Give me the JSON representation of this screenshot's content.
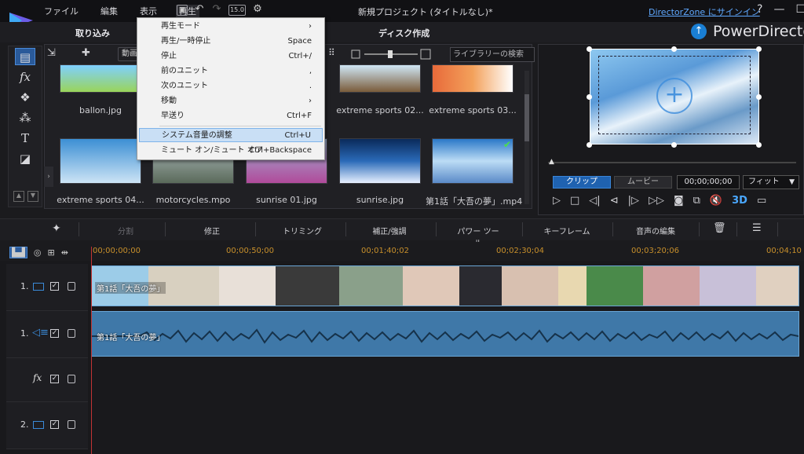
{
  "app": {
    "menu": [
      "ファイル",
      "編集",
      "表示",
      "再生"
    ],
    "window_title": "新規プロジェクト (タイトルなし)*",
    "signin": "DirectorZone にサインイン",
    "win_help": "?",
    "brand": "PowerDirector"
  },
  "quick_tools": {
    "fps_label": "15.0"
  },
  "modes": {
    "import": "取り込み",
    "disc": "ディスク作成"
  },
  "library": {
    "dropdown": "動画",
    "search_placeholder": "ライブラリーの検索",
    "row1": [
      {
        "name": "ballon.jpg"
      },
      {
        "name": ""
      },
      {
        "name": ""
      },
      {
        "name": "extreme sports 02..."
      },
      {
        "name": "extreme sports 03..."
      }
    ],
    "row2": [
      {
        "name": "extreme sports 04..."
      },
      {
        "name": "motorcycles.mpo"
      },
      {
        "name": "sunrise 01.jpg"
      },
      {
        "name": "sunrise.jpg"
      },
      {
        "name": "第1話「大吾の夢」.mp4"
      }
    ]
  },
  "context_menu": [
    {
      "label": "再生モード",
      "shortcut": "",
      "submenu": true
    },
    {
      "label": "再生/一時停止",
      "shortcut": "Space"
    },
    {
      "label": "停止",
      "shortcut": "Ctrl+/"
    },
    {
      "label": "前のユニット",
      "shortcut": ","
    },
    {
      "label": "次のユニット",
      "shortcut": "."
    },
    {
      "label": "移動",
      "shortcut": "",
      "submenu": true
    },
    {
      "label": "早送り",
      "shortcut": "Ctrl+F"
    },
    {
      "label": "システム音量の調整",
      "shortcut": "Ctrl+U",
      "highlighted": true
    },
    {
      "label": "ミュート オン/ミュート オフ",
      "shortcut": "Ctrl+Backspace"
    }
  ],
  "preview": {
    "clip_tab": "クリップ",
    "movie_tab": "ムービー",
    "timecode": "00;00;00;00",
    "fit": "フィット",
    "mode_3d": "3D"
  },
  "edit_toolbar": {
    "split": "分割",
    "fix": "修正",
    "trim": "トリミング",
    "correct": "補正/強調",
    "power": "パワー ツール",
    "keyframe": "キーフレーム",
    "audio": "音声の編集"
  },
  "ruler": [
    "00;00;00;00",
    "00;00;50;00",
    "00;01;40;02",
    "00;02;30;04",
    "00;03;20;06",
    "00;04;10"
  ],
  "tracks": {
    "video1": "1.",
    "audio1": "1.",
    "fx": "fx",
    "video2": "2."
  },
  "clips": {
    "video": "第1話「大吾の夢」",
    "audio": "第1話「大吾の夢」"
  }
}
